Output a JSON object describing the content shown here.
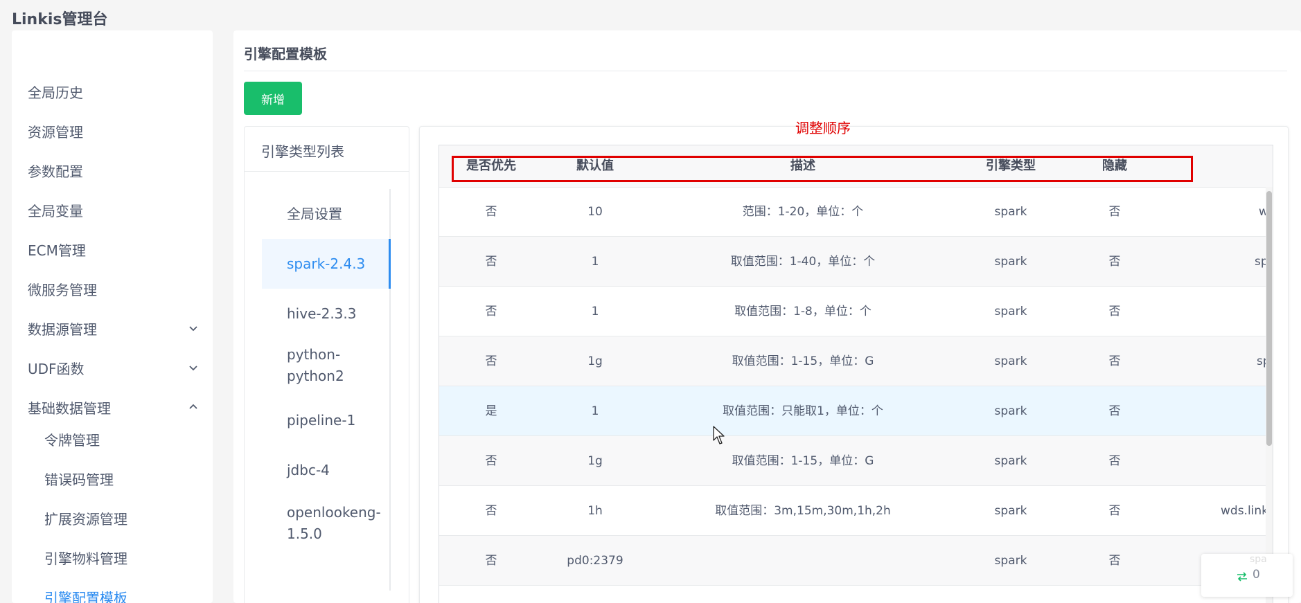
{
  "app": {
    "title": "Linkis管理台"
  },
  "sidebar": {
    "items": [
      {
        "label": "全局历史"
      },
      {
        "label": "资源管理"
      },
      {
        "label": "参数配置"
      },
      {
        "label": "全局变量"
      },
      {
        "label": "ECM管理"
      },
      {
        "label": "微服务管理"
      },
      {
        "label": "数据源管理",
        "chevron": "chevron-down-icon"
      },
      {
        "label": "UDF函数",
        "chevron": "chevron-down-icon"
      },
      {
        "label": "基础数据管理",
        "chevron": "chevron-up-icon"
      }
    ],
    "subitems": [
      {
        "label": "令牌管理"
      },
      {
        "label": "错误码管理"
      },
      {
        "label": "扩展资源管理"
      },
      {
        "label": "引擎物料管理"
      },
      {
        "label": "引擎配置模板",
        "active": true
      }
    ]
  },
  "main": {
    "title": "引擎配置模板",
    "add_button": "新增",
    "engine_list": {
      "title": "引擎类型列表",
      "items": [
        {
          "label": "全局设置"
        },
        {
          "label": "spark-2.4.3",
          "active": true
        },
        {
          "label": "hive-2.3.3"
        },
        {
          "label": "python-\npython2"
        },
        {
          "label": "pipeline-1"
        },
        {
          "label": "jdbc-4"
        },
        {
          "label": "openlookeng-\n1.5.0"
        }
      ]
    },
    "annotation": "调整顺序",
    "table": {
      "columns": [
        "是否优先",
        "默认值",
        "描述",
        "引擎类型",
        "隐藏"
      ],
      "rows": [
        {
          "priority": "否",
          "default": "10",
          "desc": "范围：1-20，单位：个",
          "engine": "spark",
          "hidden": "否",
          "extra": "w"
        },
        {
          "priority": "否",
          "default": "1",
          "desc": "取值范围：1-40，单位：个",
          "engine": "spark",
          "hidden": "否",
          "extra": "spa"
        },
        {
          "priority": "否",
          "default": "1",
          "desc": "取值范围：1-8，单位：个",
          "engine": "spark",
          "hidden": "否",
          "extra": ""
        },
        {
          "priority": "否",
          "default": "1g",
          "desc": "取值范围：1-15，单位：G",
          "engine": "spark",
          "hidden": "否",
          "extra": "sp"
        },
        {
          "priority": "是",
          "default": "1",
          "desc": "取值范围：只能取1，单位：个",
          "engine": "spark",
          "hidden": "否",
          "extra": ""
        },
        {
          "priority": "否",
          "default": "1g",
          "desc": "取值范围：1-15，单位：G",
          "engine": "spark",
          "hidden": "否",
          "extra": ""
        },
        {
          "priority": "否",
          "default": "1h",
          "desc": "取值范围：3m,15m,30m,1h,2h",
          "engine": "spark",
          "hidden": "否",
          "extra": "wds.link"
        },
        {
          "priority": "否",
          "default": "pd0:2379",
          "desc": "",
          "engine": "spark",
          "hidden": "否",
          "extra": ""
        }
      ]
    }
  },
  "badge": {
    "count": "0",
    "ghost_text": "spa",
    "icon": "swap-arrows-icon"
  },
  "colors": {
    "accent": "#2d8cf0",
    "success": "#19be6b",
    "annotation": "#e00000"
  }
}
